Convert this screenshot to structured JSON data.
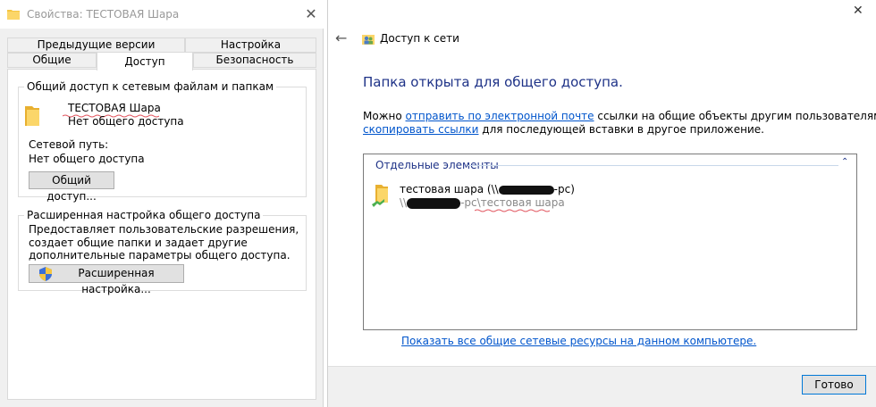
{
  "properties_dialog": {
    "title": "Свойства: ТЕСТОВАЯ Шара",
    "close_glyph": "✕",
    "tabs_row1": [
      "Предыдущие версии",
      "Настройка"
    ],
    "tabs_row2": [
      "Общие",
      "Доступ",
      "Безопасность"
    ],
    "active_tab": "Доступ",
    "sharing_group": {
      "title": "Общий доступ к сетевым файлам и папкам",
      "share_name": "ТЕСТОВАЯ Шара",
      "share_status": "Нет общего доступа",
      "network_path_label": "Сетевой путь:",
      "network_path_value": "Нет общего доступа",
      "share_button": "Общий доступ..."
    },
    "advanced_group": {
      "title": "Расширенная настройка общего доступа",
      "description": "Предоставляет пользовательские разрешения, создает общие папки и задает другие дополнительные параметры общего доступа.",
      "advanced_button": "Расширенная настройка..."
    }
  },
  "wizard": {
    "close_glyph": "✕",
    "back_glyph": "←",
    "title": "Доступ к сети",
    "heading": "Папка открыта для общего доступа.",
    "line1_prefix": "Можно ",
    "line1_link": "отправить по электронной почте",
    "line1_suffix": " ссылки на общие объекты другим пользователям или",
    "line2_link": "скопировать ссылки",
    "line2_suffix": " для последующей вставки в другое приложение.",
    "items_header": "Отдельные элементы",
    "collapse_glyph": "⌃",
    "item_name_prefix": "тестовая шара (\\\\",
    "item_name_suffix": "-pc)",
    "item_path_prefix": "\\\\",
    "item_path_suffix": "-pc\\тестовая шара",
    "show_all_link": "Показать все общие сетевые ресурсы на данном компьютере.",
    "done_button": "Готово"
  },
  "colors": {
    "accent_blue": "#1e3287",
    "link_blue": "#0055cc",
    "folder_yellow": "#f5c542",
    "squiggle_red": "#e0505a"
  }
}
